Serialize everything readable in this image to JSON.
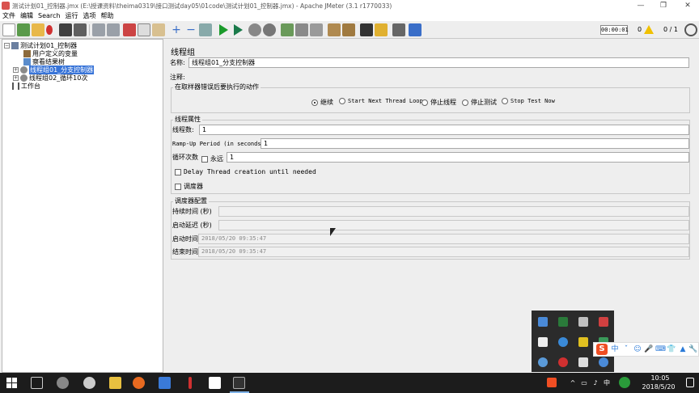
{
  "window": {
    "title": "测试计划01_控制器.jmx (E:\\授课资料\\theima0319\\接口测试day05\\01code\\测试计划01_控制器.jmx) - Apache JMeter (3.1 r1770033)",
    "minimize_glyph": "—",
    "maximize_glyph": "❐",
    "close_glyph": "✕"
  },
  "menu": [
    "文件",
    "编辑",
    "Search",
    "运行",
    "选项",
    "帮助"
  ],
  "status": {
    "elapsed_time": "00:00:01",
    "warning_count": "0",
    "thread_ratio": "0 / 1"
  },
  "tree": {
    "nodes": [
      {
        "label": "测试计划01_控制器",
        "level": 0,
        "expander": "−",
        "icon_color": "#6a7fa0",
        "selected": false
      },
      {
        "label": "用户定义的变量",
        "level": 1,
        "expander": "",
        "icon_color": "#8c6a3c",
        "selected": false
      },
      {
        "label": "察看结果树",
        "level": 1,
        "expander": "",
        "icon_color": "#5a8ccc",
        "selected": false
      },
      {
        "label": "线程组01_分支控制器",
        "level": 1,
        "expander": "+",
        "icon_color": "#8a8a8a",
        "selected": true
      },
      {
        "label": "线程组02_循环10次",
        "level": 1,
        "expander": "+",
        "icon_color": "#8a8a8a",
        "selected": false
      },
      {
        "label": "工作台",
        "level": 0,
        "expander": "",
        "icon_color": "#555555",
        "selected": false
      }
    ]
  },
  "panel": {
    "title": "线程组",
    "name_label": "名称:",
    "name_value": "线程组01_分支控制器",
    "comment_label": "注释:",
    "comment_value": "",
    "error_action": {
      "title": "在取样器错误后要执行的动作",
      "options": [
        "继续",
        "Start Next Thread Loop",
        "停止线程",
        "停止测试",
        "Stop Test Now"
      ],
      "selected_index": 0
    },
    "thread_props": {
      "title": "线程属性",
      "threads_label": "线程数:",
      "threads_value": "1",
      "rampup_label": "Ramp-Up Period (in seconds):",
      "rampup_value": "1",
      "loop_label": "循环次数",
      "forever_label": "永远",
      "loop_value": "1",
      "delay_label": "Delay Thread creation until needed",
      "scheduler_label": "调度器"
    },
    "scheduler": {
      "title": "调度器配置",
      "duration_label": "持续时间 (秒)",
      "duration_value": "",
      "delay_label": "启动延迟 (秒)",
      "delay_value": "",
      "start_label": "启动时间",
      "start_value": "2018/05/20 09:35:47",
      "end_label": "结束时间",
      "end_value": "2018/05/20 09:35:47"
    }
  },
  "ime": {
    "logo": "S",
    "lang": "中",
    "items": [
      "ˇ",
      "☺",
      "🎤",
      "⌨",
      "👕",
      "▲",
      "🔧"
    ]
  },
  "taskbar": {
    "time": "10:05",
    "date": "2018/5/20",
    "tray_glyphs": [
      "^",
      "▭",
      "♪",
      "中"
    ]
  },
  "colors": {
    "selection": "#3874d8",
    "taskbar": "#1c1c1c",
    "accent_blue": "#7fb2e8"
  }
}
